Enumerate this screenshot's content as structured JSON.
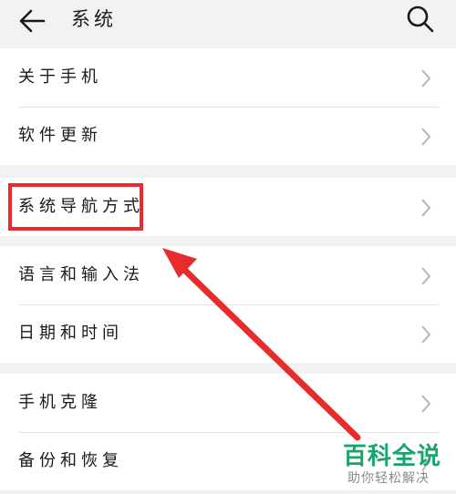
{
  "header": {
    "title": "系统",
    "back_icon": "back-arrow-icon",
    "search_icon": "search-icon"
  },
  "groups": [
    {
      "items": [
        {
          "label": "关于手机"
        },
        {
          "label": "软件更新"
        }
      ]
    },
    {
      "items": [
        {
          "label": "系统导航方式"
        }
      ]
    },
    {
      "items": [
        {
          "label": "语言和输入法"
        },
        {
          "label": "日期和时间"
        }
      ]
    },
    {
      "items": [
        {
          "label": "手机克隆"
        },
        {
          "label": "备份和恢复"
        }
      ]
    }
  ],
  "annotation": {
    "color": "#e82c2c",
    "highlighted_item": "系统导航方式"
  },
  "watermark": {
    "main": "百科全说",
    "sub": "助你轻松解决",
    "color": "#1aa36a"
  }
}
